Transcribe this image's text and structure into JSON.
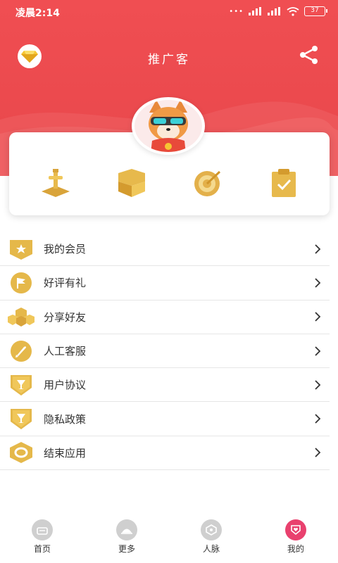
{
  "status_bar": {
    "time": "凌晨2:14",
    "signal_dots": "•••",
    "battery": "37"
  },
  "header": {
    "title": "推广客",
    "vip_icon": "diamond-icon",
    "share_icon": "share-icon"
  },
  "quick_actions": [
    {
      "icon": "sword-icon"
    },
    {
      "icon": "cube-icon"
    },
    {
      "icon": "target-icon"
    },
    {
      "icon": "clipboard-check-icon"
    }
  ],
  "menu": [
    {
      "label": "我的会员",
      "icon": "star-badge-icon"
    },
    {
      "label": "好评有礼",
      "icon": "flag-icon"
    },
    {
      "label": "分享好友",
      "icon": "friends-icon"
    },
    {
      "label": "人工客服",
      "icon": "rocket-icon"
    },
    {
      "label": "用户协议",
      "icon": "cup-shield-icon"
    },
    {
      "label": "隐私政策",
      "icon": "cup-shield-icon"
    },
    {
      "label": "结束应用",
      "icon": "hexagon-icon"
    }
  ],
  "tabbar": [
    {
      "label": "首页",
      "icon": "home-icon",
      "active": false
    },
    {
      "label": "更多",
      "icon": "more-icon",
      "active": false
    },
    {
      "label": "人脉",
      "icon": "network-icon",
      "active": false
    },
    {
      "label": "我的",
      "icon": "heart-shield-icon",
      "active": true
    }
  ],
  "colors": {
    "brand_red": "#e8474b",
    "gold": "#e5b84a",
    "active_pink": "#e9416e"
  }
}
